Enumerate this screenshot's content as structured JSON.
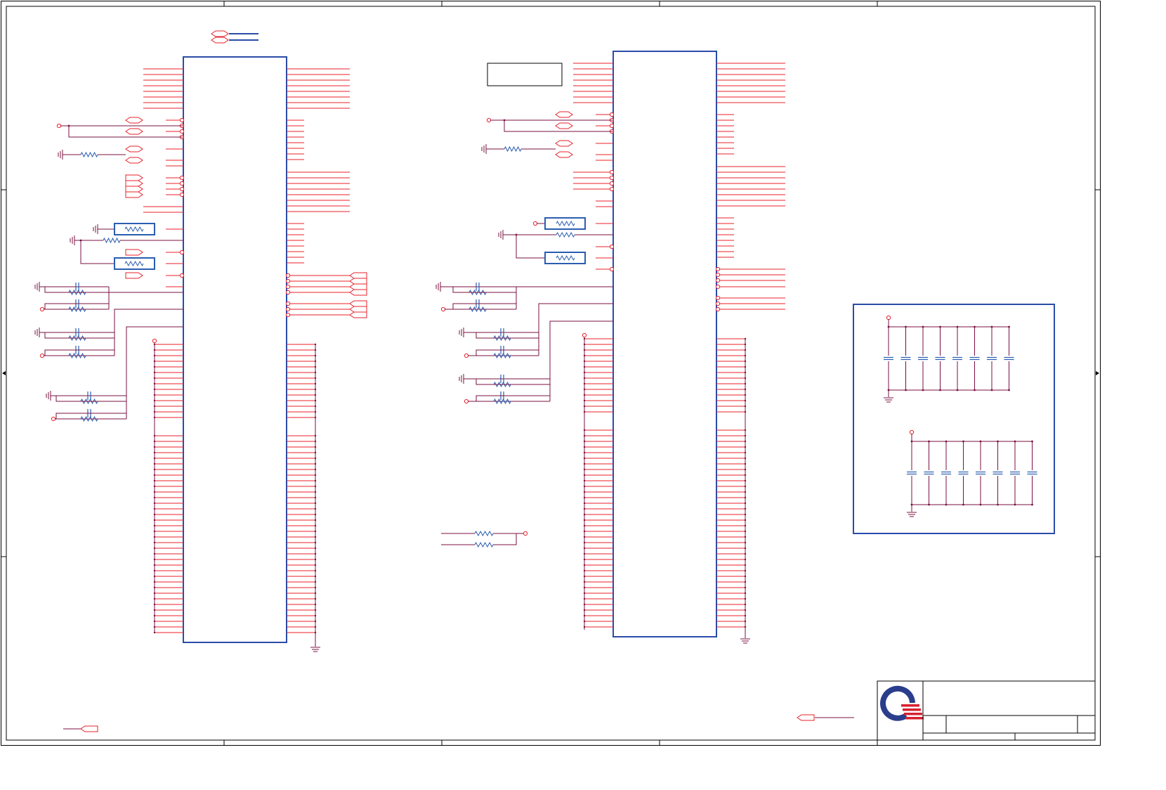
{
  "colors": {
    "background": "#ffffff",
    "frame": "#000000",
    "component_body": "#2a4ca8",
    "pin": "#e8202a",
    "net_wire": "#7a1040",
    "resistor_net": "#2a5db0",
    "logo_blue": "#2a3e8c",
    "logo_red": "#d82030"
  },
  "icons": [
    "ground-symbol-icon",
    "resistor-symbol-icon",
    "capacitor-symbol-icon",
    "net-port-icon",
    "company-logo-icon"
  ],
  "title_block": {
    "sheet_title": "",
    "document_number": "",
    "revision": "",
    "size": "",
    "date": "",
    "sheet": ""
  }
}
